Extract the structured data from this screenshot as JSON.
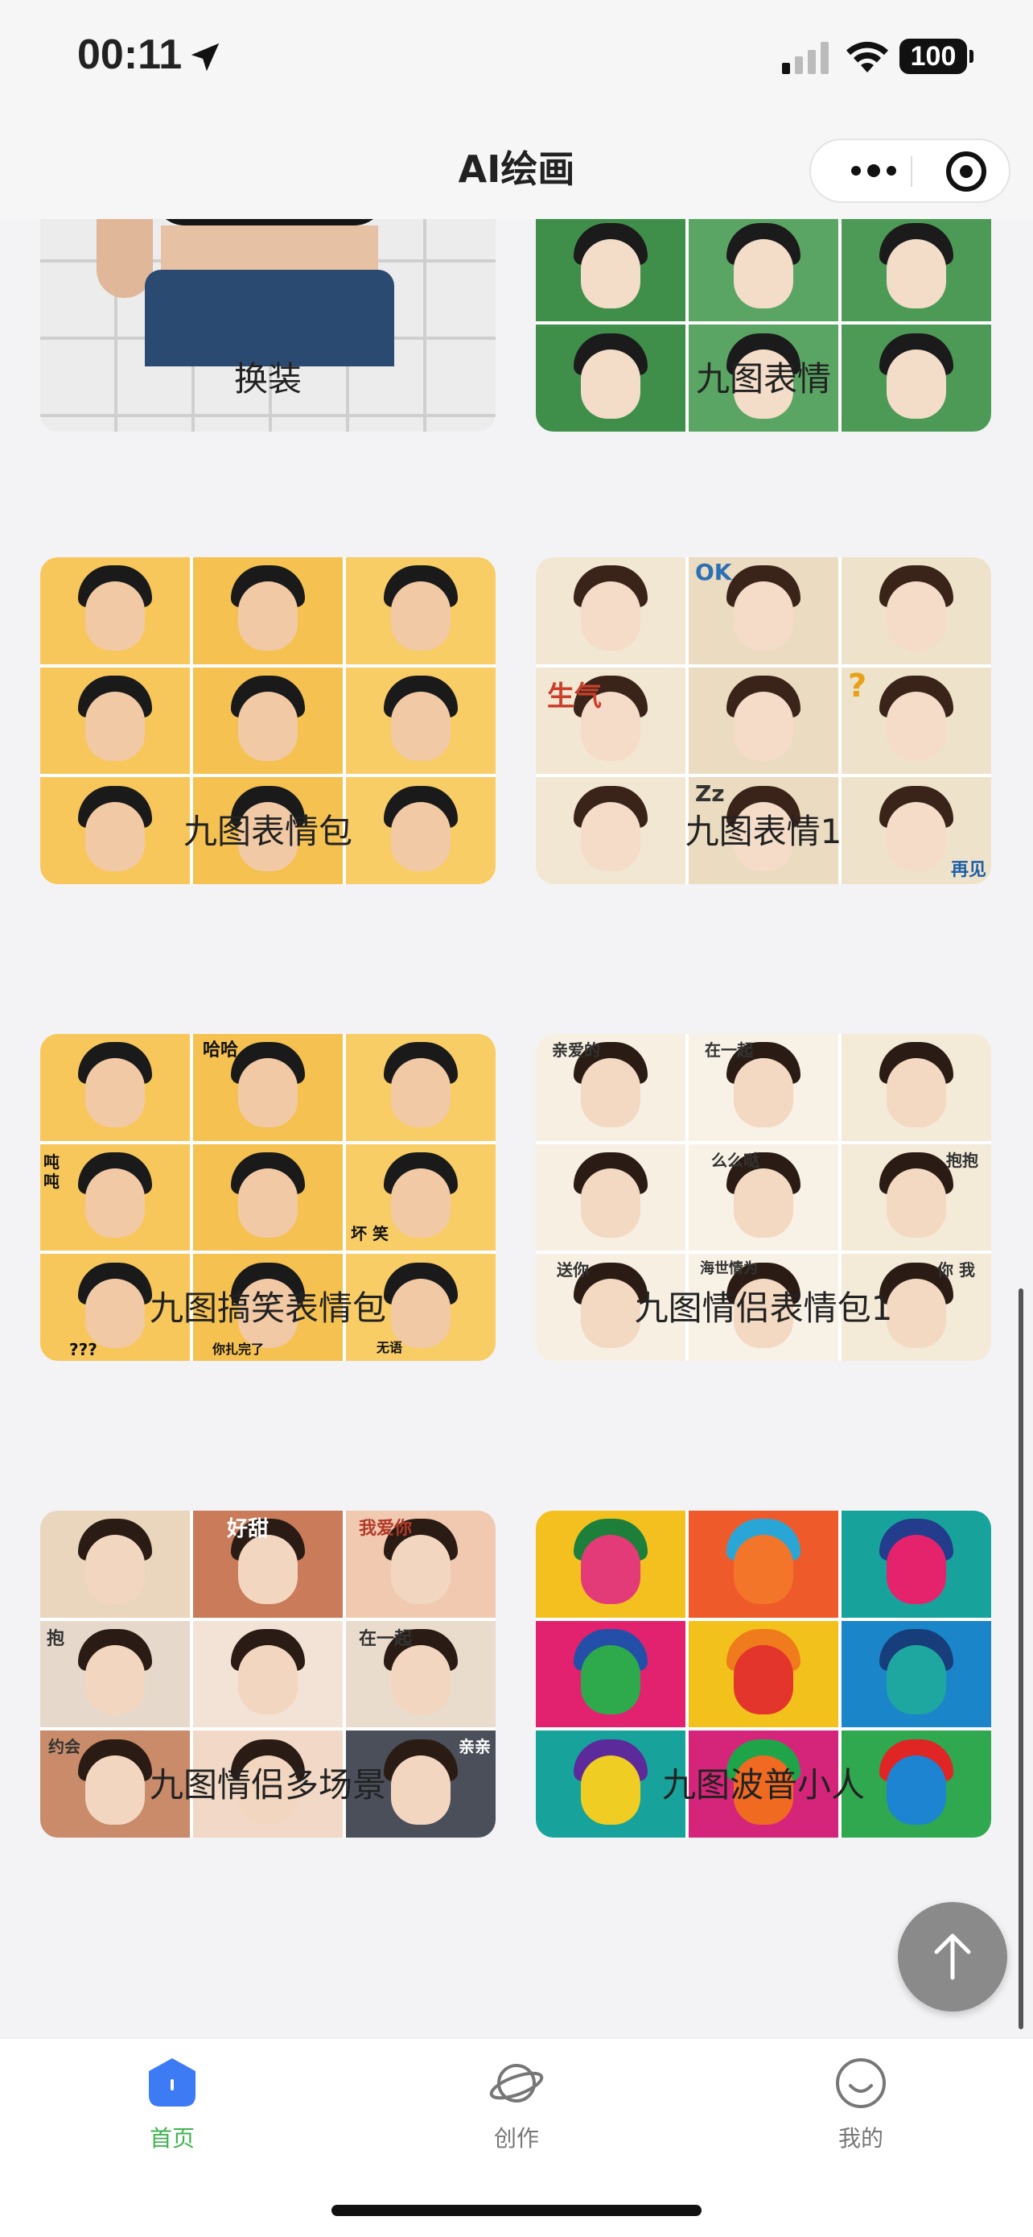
{
  "status_bar": {
    "time": "00:11",
    "battery": "100"
  },
  "nav": {
    "title": "AI绘画"
  },
  "cards": [
    {
      "title": "换装"
    },
    {
      "title": "九图表情"
    },
    {
      "title": "九图表情包"
    },
    {
      "title": "九图表情1"
    },
    {
      "title": "九图搞笑表情包"
    },
    {
      "title": "九图情侣表情包1"
    },
    {
      "title": "九图情侣多场景"
    },
    {
      "title": "九图波普小人"
    }
  ],
  "image_text": {
    "grid4": {
      "ok": "OK",
      "angry": "生气",
      "sleep": "Zz",
      "question": "?",
      "bye": "再见"
    },
    "grid5": {
      "haha": "哈哈",
      "drink": "吨吨",
      "bad_laugh": "坏 笑",
      "dots": "???",
      "fish": "你扎完了",
      "speechless": "无语"
    },
    "grid6": {
      "dear": "亲爱的",
      "together": "在一起",
      "mwah": "么么哒",
      "hug": "抱抱",
      "gift": "送你",
      "promise": "海世情为",
      "you_me": "你 我"
    },
    "grid7": {
      "sweet": "好甜",
      "love": "我爱你",
      "hold": "抱",
      "together": "在一起",
      "date": "约会",
      "kiss": "亲亲"
    }
  },
  "tabs": [
    {
      "label": "首页",
      "icon": "home-icon",
      "active": true
    },
    {
      "label": "创作",
      "icon": "planet-icon",
      "active": false
    },
    {
      "label": "我的",
      "icon": "smile-icon",
      "active": false
    }
  ],
  "colors": {
    "active_tab": "#3fb34f",
    "home_icon": "#3d7bf5",
    "background": "#f3f3f5"
  }
}
